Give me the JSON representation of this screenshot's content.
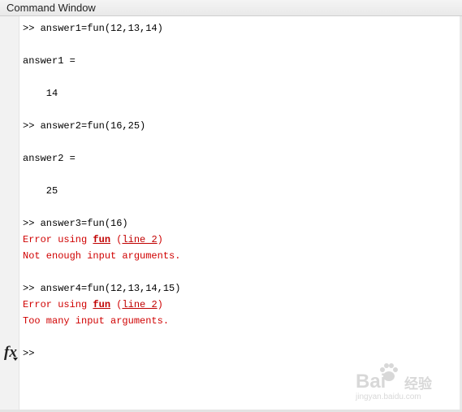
{
  "window": {
    "title": "Command Window"
  },
  "console": {
    "cmd1": ">> answer1=fun(12,13,14)",
    "out1_label": "answer1 =",
    "out1_value": "    14",
    "cmd2": ">> answer2=fun(16,25)",
    "out2_label": "answer2 =",
    "out2_value": "    25",
    "cmd3": ">> answer3=fun(16)",
    "err1": {
      "prefix": "Error using ",
      "func": "fun",
      "sep": " (",
      "line": "line 2",
      "suffix": ")",
      "message": "Not enough input arguments."
    },
    "cmd4": ">> answer4=fun(12,13,14,15)",
    "err2": {
      "prefix": "Error using ",
      "func": "fun",
      "sep": " (",
      "line": "line 2",
      "suffix": ")",
      "message": "Too many input arguments."
    },
    "prompt": ">>"
  },
  "watermark": {
    "brand": "Bai",
    "brand_cn": "经验",
    "url": "jingyan.baidu.com"
  },
  "colors": {
    "error": "#d00000",
    "gutter": "#f2f2f2",
    "titlebar": "#ececec"
  },
  "icons": {
    "function_browser": "fx-icon"
  }
}
